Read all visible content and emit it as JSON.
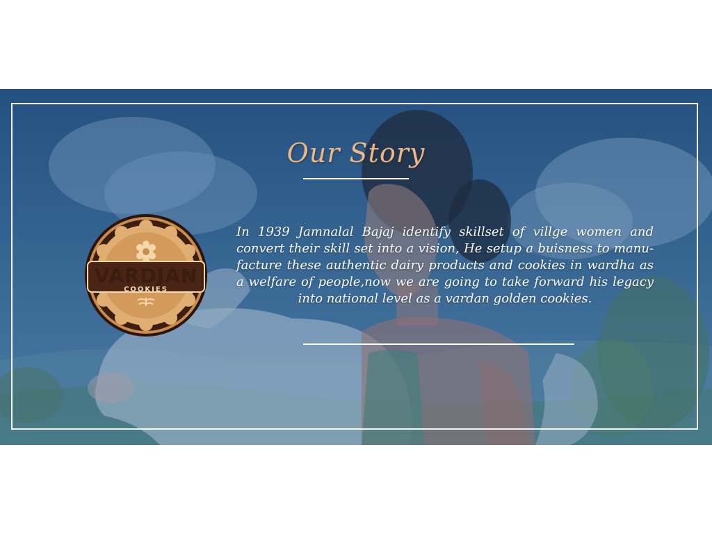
{
  "section": {
    "title": "Our Story",
    "story_text": "In 1939 Jamnalal  Bajaj  identify skillset of villge women and convert their skill set into a vision, He setup a buisness to manu-facture these authentic dairy products and cookies in wardha as a welfare of people,now we are going to take forward his legacy into national level as a vardan golden cookies."
  },
  "logo": {
    "brand": "VARDJAN",
    "sub": "COOKIES",
    "icon": "cookie-badge-icon"
  },
  "colors": {
    "banner_blue": "#2f5f8d",
    "title_gold": "#e7b98b",
    "logo_brown": "#3a1d10",
    "cookie_tan": "#d9a66b"
  }
}
